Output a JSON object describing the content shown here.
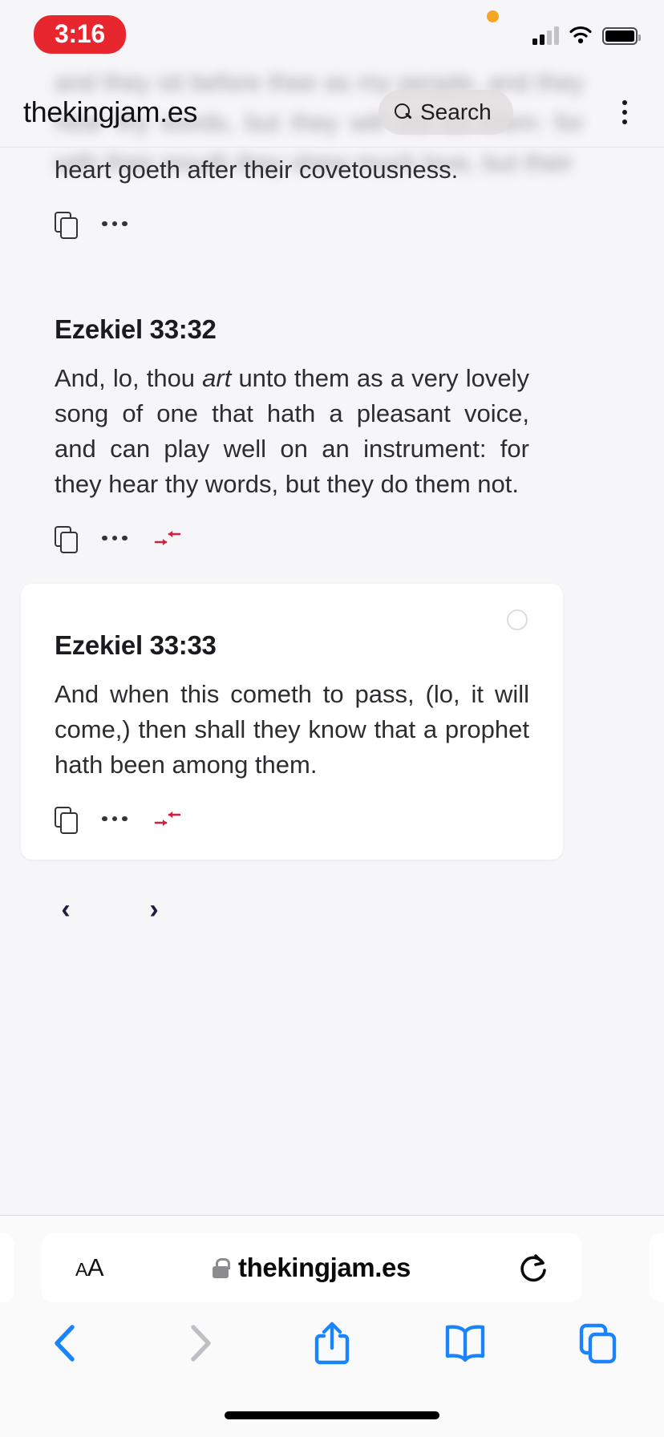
{
  "status_bar": {
    "time": "3:16",
    "time_pill_color": "#e8262d",
    "privacy_dot_color": "#f5a623",
    "cellular_icon": "cellular-signal-icon",
    "wifi_icon": "wifi-icon",
    "battery_icon": "battery-full-icon"
  },
  "site_header": {
    "title": "thekingjam.es",
    "search_label": "Search",
    "search_icon": "search-icon",
    "menu_icon": "kebab-menu-icon"
  },
  "background_text": "and they sit before thee as my people, and they hear thy words, but they will not do them: for with their mouth they shew much love, but their",
  "verses": [
    {
      "reference": "",
      "text": "heart goeth after their covetousness.",
      "actions": [
        "copy-icon",
        "more-options-icon"
      ],
      "highlighted": false
    },
    {
      "reference": "Ezekiel 33:32",
      "text_before_italic": "And, lo, thou ",
      "italic": "art",
      "text_after_italic": " unto them as a very lovely song of one that hath a pleasant voice, and can play well on an instrument: for they hear thy words, but they do them not.",
      "actions": [
        "copy-icon",
        "more-options-icon",
        "compress-icon"
      ],
      "highlighted": false
    },
    {
      "reference": "Ezekiel 33:33",
      "text": "And when this cometh to pass, (lo, it will come,) then shall they know that a prophet hath been among them.",
      "actions": [
        "copy-icon",
        "more-options-icon",
        "compress-icon"
      ],
      "highlighted": true,
      "marker_icon": "circle-outline-icon"
    }
  ],
  "pagination": {
    "prev_icon": "chevron-left-icon",
    "prev_label": "‹",
    "next_icon": "chevron-right-icon",
    "next_label": "›"
  },
  "browser": {
    "text_size_small": "A",
    "text_size_large": "A",
    "lock_icon": "lock-icon",
    "url": "thekingjam.es",
    "reload_icon": "reload-icon",
    "toolbar": {
      "back_icon": "back-chevron-icon",
      "forward_icon": "forward-chevron-icon",
      "share_icon": "share-icon",
      "bookmarks_icon": "book-icon",
      "tabs_icon": "tabs-icon"
    }
  },
  "colors": {
    "page_background": "#f6f5f7",
    "card_background": "#ffffff",
    "accent_red": "#d61f3c",
    "safari_blue": "#1a84ff",
    "pagination_navy": "#241a42"
  }
}
